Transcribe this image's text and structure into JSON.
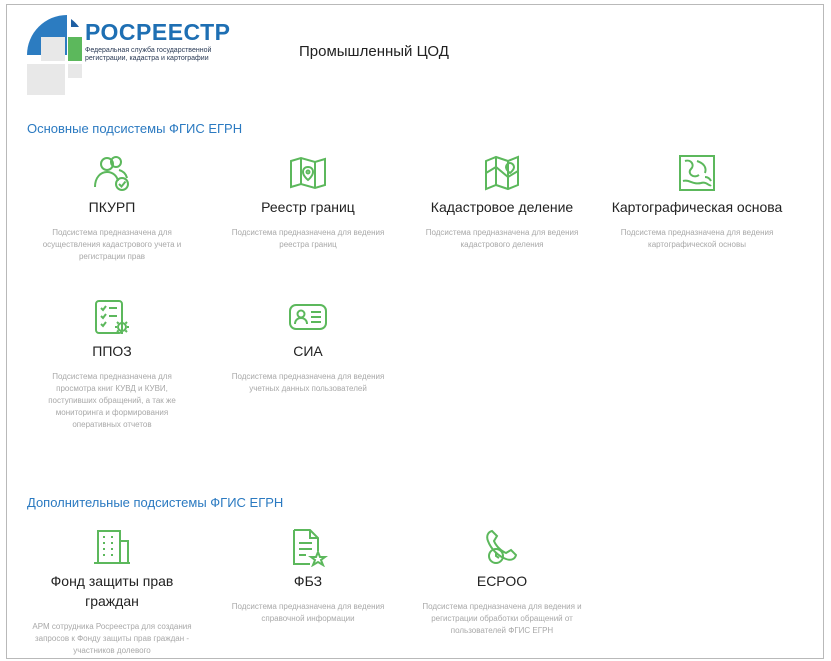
{
  "header": {
    "brand": "РОСРЕЕСТР",
    "brand_sub": "Федеральная служба государственной регистрации, кадастра и картографии",
    "title": "Промышленный ЦОД"
  },
  "sections": {
    "main": {
      "title": "Основные подсистемы ФГИС ЕГРН",
      "tiles": [
        {
          "name": "ПКУРП",
          "desc": "Подсистема предназначена для осуществления кадастрового учета и регистрации прав",
          "icon": "users-check-icon"
        },
        {
          "name": "Реестр границ",
          "desc": "Подсистема предназначена для ведения реестра границ",
          "icon": "map-pin-icon"
        },
        {
          "name": "Кадастровое деление",
          "desc": "Подсистема предназначена для ведения кадастрового деления",
          "icon": "map-division-icon"
        },
        {
          "name": "Картографическая основа",
          "desc": "Подсистема предназначена для ведения картографической основы",
          "icon": "topographic-map-icon"
        },
        {
          "name": "ППОЗ",
          "desc": "Подсистема предназначена для просмотра книг КУВД и КУВИ, поступивших обращений, а так же мониторинга и формирования оперативных отчетов",
          "icon": "checklist-gear-icon"
        },
        {
          "name": "СИА",
          "desc": "Подсистема предназначена для ведения учетных данных пользователей",
          "icon": "id-card-icon"
        }
      ]
    },
    "extra": {
      "title": "Дополнительные подсистемы ФГИС ЕГРН",
      "tiles": [
        {
          "name": "Фонд защиты прав граждан",
          "desc": "АРМ сотрудника Росреестра для создания запросов к Фонду защиты прав граждан - участников долевого",
          "icon": "building-icon"
        },
        {
          "name": "ФБЗ",
          "desc": "Подсистема предназначена для ведения справочной информации",
          "icon": "document-star-icon"
        },
        {
          "name": "ЕСРОО",
          "desc": "Подсистема предназначена для ведения и регистрации обработки обращений от пользователей ФГИС ЕГРН",
          "icon": "phone-clock-icon"
        }
      ]
    }
  },
  "colors": {
    "accent": "#2b7ac1",
    "icon_green": "#5cb85c",
    "desc_gray": "#a8a8a8"
  }
}
